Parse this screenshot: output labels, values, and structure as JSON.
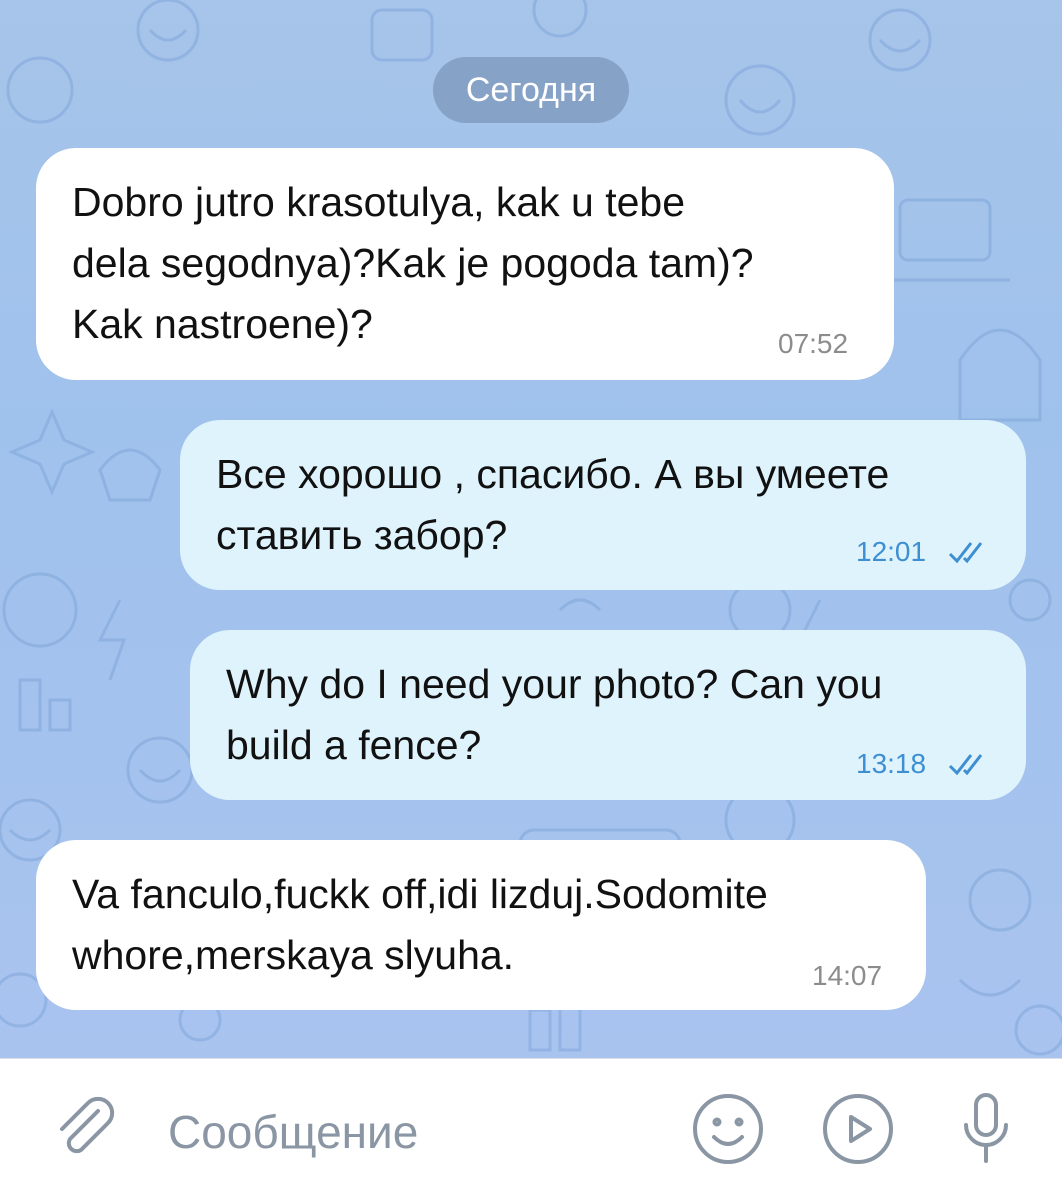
{
  "chat": {
    "date_label": "Сегодня",
    "messages": [
      {
        "direction": "incoming",
        "text": "Dobro jutro krasotulya, kak u tebe\ndela segodnya)?Kak je pogoda tam)?\nKak nastroene)?",
        "time": "07:52"
      },
      {
        "direction": "outgoing",
        "text": "Все хорошо , спасибо. А вы умеете\nставить забор?",
        "time": "12:01",
        "status": "read"
      },
      {
        "direction": "outgoing",
        "text": "Why do I need your photo? Can you\nbuild a fence?",
        "time": "13:18",
        "status": "read"
      },
      {
        "direction": "incoming",
        "text": "Va fanculo,fuckk off,idi lizduj.Sodomite\nwhore,merskaya slyuha.",
        "time": "14:07"
      }
    ]
  },
  "input_bar": {
    "placeholder": "Сообщение",
    "icons": [
      "paperclip-icon",
      "emoji-icon",
      "video-message-icon",
      "microphone-icon"
    ]
  },
  "colors": {
    "incoming_bubble": "#ffffff",
    "outgoing_bubble": "#dff3fd",
    "read_check": "#3d8fd1",
    "wallpaper": "#a7c4ea"
  }
}
